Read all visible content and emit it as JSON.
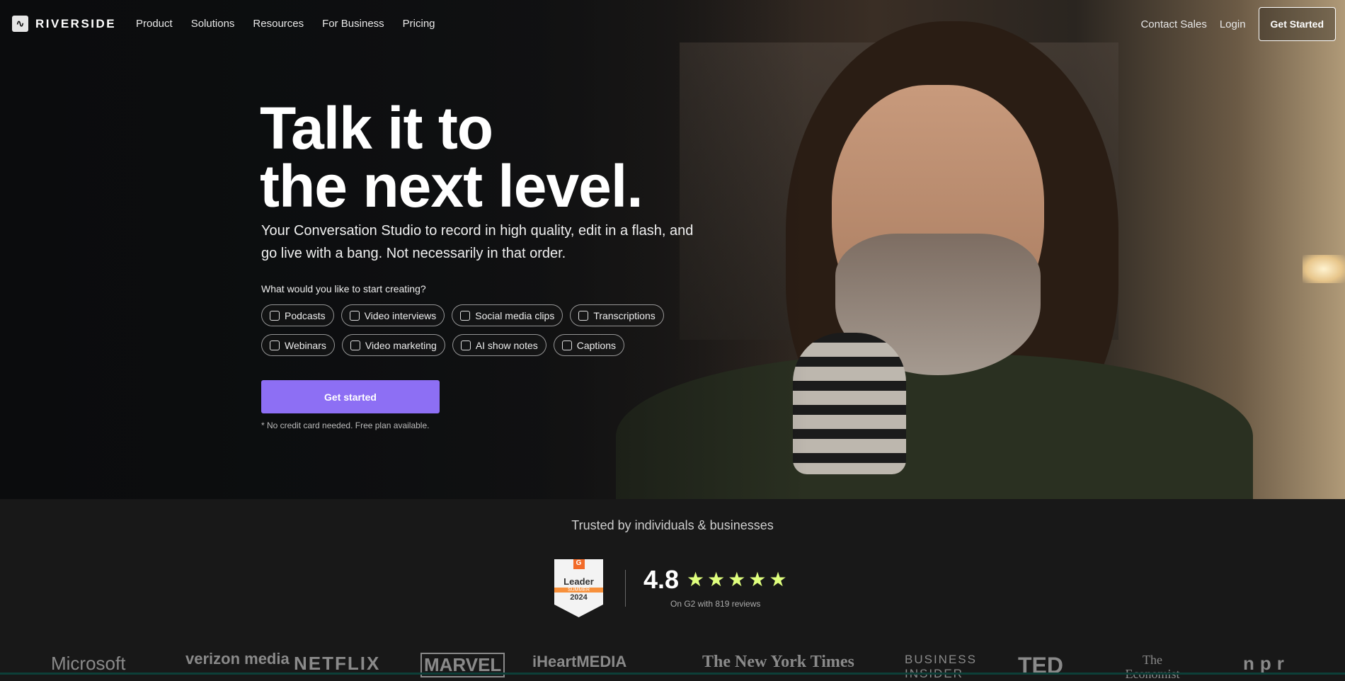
{
  "nav": {
    "brand": "RIVERSIDE",
    "links": [
      "Product",
      "Solutions",
      "Resources",
      "For Business",
      "Pricing"
    ],
    "contact": "Contact Sales",
    "login": "Login",
    "get_started": "Get Started"
  },
  "hero": {
    "title_line1": "Talk it to",
    "title_line2": "the next level.",
    "subtitle": "Your Conversation Studio to record in high quality, edit in a flash, and go live with a bang. Not necessarily in that order.",
    "question": "What would you like to start creating?",
    "options": [
      "Podcasts",
      "Video interviews",
      "Social media clips",
      "Transcriptions",
      "Webinars",
      "Video marketing",
      "AI show notes",
      "Captions"
    ],
    "cta": "Get started",
    "note": "* No credit card needed. Free plan available.",
    "accent": "#8d6ff4"
  },
  "trust": {
    "heading": "Trusted by individuals & businesses",
    "badge": {
      "brand": "G",
      "title": "Leader",
      "season": "SUMMER",
      "year": "2024"
    },
    "rating": "4.8",
    "stars": 5,
    "reviews": "On G2 with 819 reviews",
    "star_color": "#dfff7e"
  },
  "logos": [
    "Microsoft",
    "verizon media",
    "NETFLIX",
    "MARVEL",
    "iHeartMEDIA",
    "The New York Times",
    "BUSINESS INSIDER",
    "TED",
    "The Economist",
    "npr"
  ]
}
